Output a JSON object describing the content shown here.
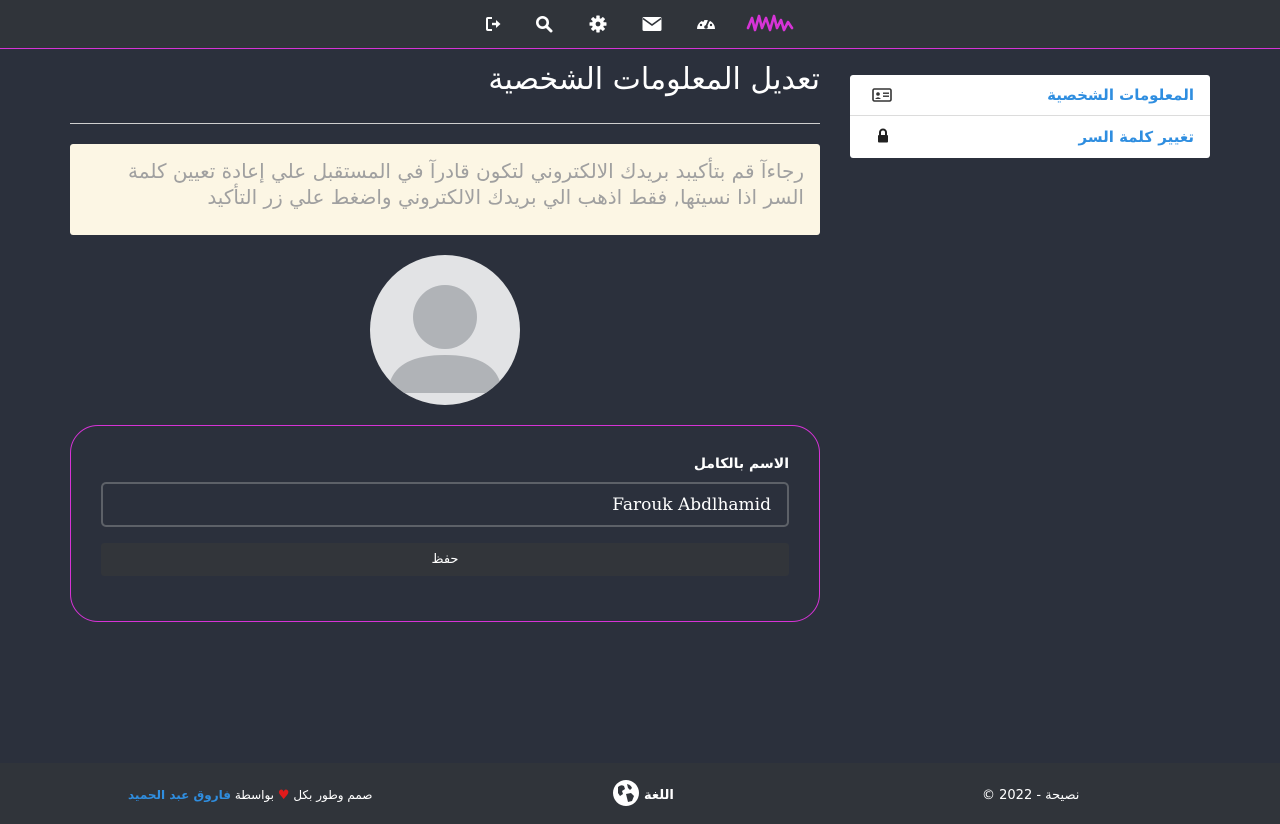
{
  "nav": {
    "icons": [
      "logout-icon",
      "search-icon",
      "gear-icon",
      "envelope-icon",
      "dashboard-icon",
      "brand-logo-icon"
    ]
  },
  "sidebar": {
    "items": [
      {
        "label": "المعلومات الشخصية",
        "icon": "id-card-icon"
      },
      {
        "label": "تغيير كلمة السر",
        "icon": "lock-icon"
      }
    ]
  },
  "main": {
    "title": "تعديل المعلومات الشخصية",
    "alert": "رجاءآ قم بتأكيبد بريدك الالكتروني لتكون قادرآ في المستقبل علي إعادة تعيين كلمة السر اذا نسيتها, فقط اذهب الي بريدك الالكتروني واضغط علي زر التأكيد"
  },
  "form": {
    "name_label": "الاسم بالكامل",
    "name_value": "Farouk Abdlhamid",
    "save_label": "حفظ"
  },
  "footer": {
    "credit_prefix": "صمم وطور بكل",
    "credit_by": "بواسطة",
    "author": "فاروق عبد الحميد",
    "language_label": "اللغة",
    "copyright": "© 2022 - نصيحة"
  },
  "colors": {
    "background": "#2b303c",
    "bar": "#30343a",
    "accent": "#d633d6",
    "link": "#2f8ee0",
    "alert_bg": "#fcf6e4"
  }
}
